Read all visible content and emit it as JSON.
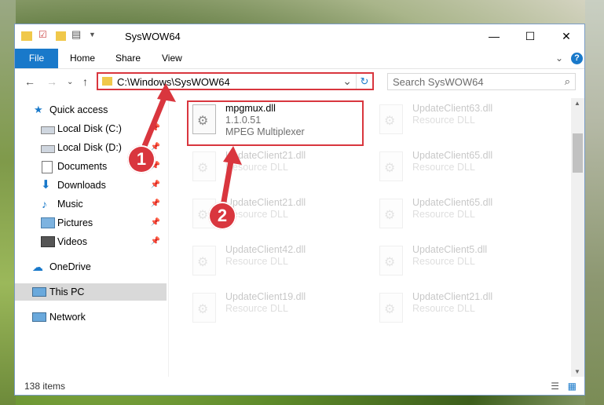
{
  "window": {
    "title": "SysWOW64",
    "controls": {
      "minimize": "—",
      "maximize": "☐",
      "close": "✕"
    }
  },
  "ribbon": {
    "tabs": [
      "File",
      "Home",
      "Share",
      "View"
    ],
    "expand": "⌄",
    "help": "?"
  },
  "address": {
    "path": "C:\\Windows\\SysWOW64",
    "refresh": "↻",
    "dropdown": "⌄"
  },
  "search": {
    "placeholder": "Search SysWOW64"
  },
  "nav": {
    "back": "←",
    "forward": "→",
    "recent": "⌄",
    "up": "↑"
  },
  "navpane": {
    "items": [
      {
        "label": "Quick access",
        "icon": "star-icon"
      },
      {
        "label": "Local Disk (C:)",
        "icon": "drive-icon",
        "pinned": true
      },
      {
        "label": "Local Disk (D:)",
        "icon": "drive-icon",
        "pinned": true
      },
      {
        "label": "Documents",
        "icon": "documents-icon",
        "pinned": true
      },
      {
        "label": "Downloads",
        "icon": "downloads-icon",
        "pinned": true
      },
      {
        "label": "Music",
        "icon": "music-icon",
        "pinned": true
      },
      {
        "label": "Pictures",
        "icon": "pictures-icon",
        "pinned": true
      },
      {
        "label": "Videos",
        "icon": "videos-icon",
        "pinned": true
      },
      {
        "label": "OneDrive",
        "icon": "cloud-icon"
      },
      {
        "label": "This PC",
        "icon": "pc-icon",
        "selected": true
      },
      {
        "label": "Network",
        "icon": "network-icon"
      }
    ]
  },
  "files": {
    "highlighted": {
      "name": "mpgmux.dll",
      "version": "1.1.0.51",
      "description": "MPEG Multiplexer"
    },
    "col1": [
      {
        "name": "UpdateClient21.dll",
        "desc": "Resource DLL"
      },
      {
        "name": "UpdateClient21.dll",
        "desc": "Resource DLL"
      },
      {
        "name": "UpdateClient42.dll",
        "desc": "Resource DLL"
      },
      {
        "name": "UpdateClient19.dll",
        "desc": "Resource DLL"
      }
    ],
    "col2": [
      {
        "name": "UpdateClient63.dll",
        "desc": "Resource DLL"
      },
      {
        "name": "UpdateClient65.dll",
        "desc": "Resource DLL"
      },
      {
        "name": "UpdateClient65.dll",
        "desc": "Resource DLL"
      },
      {
        "name": "UpdateClient5.dll",
        "desc": "Resource DLL"
      },
      {
        "name": "UpdateClient21.dll",
        "desc": "Resource DLL"
      }
    ]
  },
  "status": {
    "count": "138 items"
  },
  "annotations": {
    "badge1": "1",
    "badge2": "2"
  },
  "colors": {
    "accent": "#1979ca",
    "highlight": "#d9363e"
  }
}
